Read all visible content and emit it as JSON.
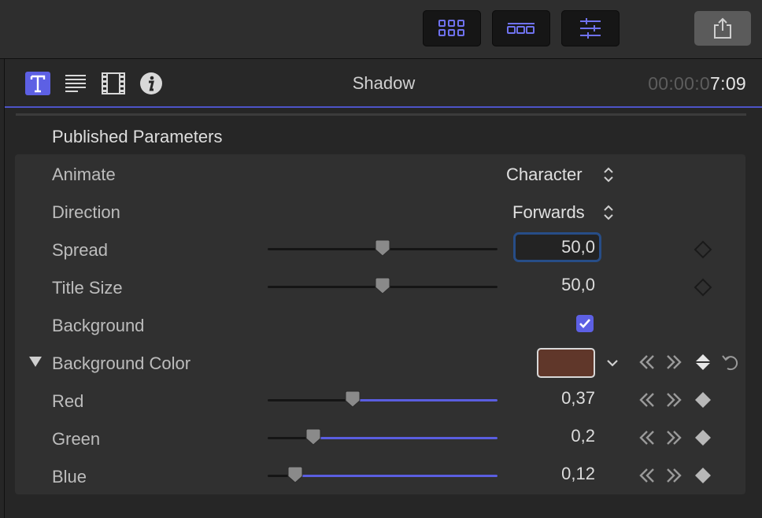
{
  "toolbar": {
    "buttons": [
      "browser-grid-icon",
      "timeline-icon",
      "inspector-sliders-icon"
    ],
    "share_icon": "share-icon"
  },
  "inspector": {
    "tabs": [
      "title-icon",
      "text-icon",
      "video-icon",
      "info-icon"
    ],
    "title": "Shadow",
    "timecode_dim": "00:00:0",
    "timecode_bright": "7:09"
  },
  "section": {
    "title": "Published Parameters"
  },
  "params": {
    "animate": {
      "label": "Animate",
      "value": "Character"
    },
    "direction": {
      "label": "Direction",
      "value": "Forwards"
    },
    "spread": {
      "label": "Spread",
      "value": "50,0",
      "level": 0.5
    },
    "title_size": {
      "label": "Title Size",
      "value": "50,0",
      "level": 0.5
    },
    "background": {
      "label": "Background",
      "checked": true
    },
    "background_color": {
      "label": "Background Color",
      "color": "#60372a",
      "expanded": true
    },
    "red": {
      "label": "Red",
      "value": "0,37",
      "level": 0.37
    },
    "green": {
      "label": "Green",
      "value": "0,2",
      "level": 0.2
    },
    "blue": {
      "label": "Blue",
      "value": "0,12",
      "level": 0.12
    }
  },
  "colors": {
    "accent": "#5a5ee0",
    "focus_ring": "#274d87"
  }
}
